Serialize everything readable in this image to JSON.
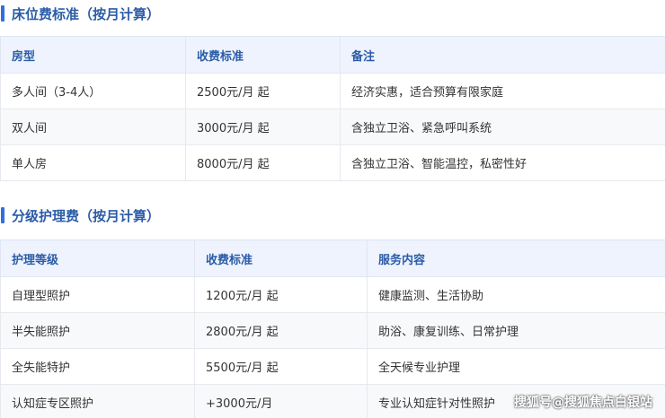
{
  "sections": [
    {
      "title": "床位费标准（按月计算）",
      "headers": [
        "房型",
        "收费标准",
        "备注"
      ],
      "rows": [
        [
          "多人间（3-4人）",
          "2500元/月 起",
          "经济实惠，适合预算有限家庭"
        ],
        [
          "双人间",
          "3000元/月 起",
          "含独立卫浴、紧急呼叫系统"
        ],
        [
          "单人房",
          "8000元/月 起",
          "含独立卫浴、智能温控，私密性好"
        ]
      ]
    },
    {
      "title": "分级护理费（按月计算）",
      "headers": [
        "护理等级",
        "收费标准",
        "服务内容"
      ],
      "rows": [
        [
          "自理型照护",
          "1200元/月 起",
          "健康监测、生活协助"
        ],
        [
          "半失能照护",
          "2800元/月 起",
          "助浴、康复训练、日常护理"
        ],
        [
          "全失能特护",
          "5500元/月 起",
          "全天候专业护理"
        ],
        [
          "认知症专区照护",
          "+3000元/月",
          "专业认知症针对性照护"
        ]
      ]
    }
  ],
  "watermark": "搜狐号@搜狐焦点白银站"
}
